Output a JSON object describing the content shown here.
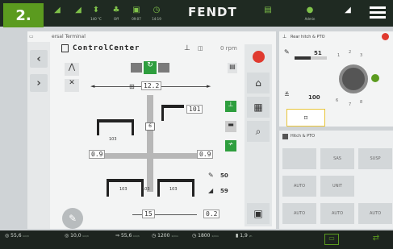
{
  "step_badge": "2.",
  "brand": "FENDT",
  "top_labels": [
    "140 °C",
    "Off",
    "09:07",
    "14:19",
    "Admin"
  ],
  "panel_title": "ersal Terminal",
  "controlcenter": {
    "title": "ControlCenter",
    "rpm": "0 rpm",
    "speed_display": "12.2",
    "rear_gauge": "101",
    "left_width": "0.9",
    "right_width": "0.9",
    "left_tool": "103",
    "mid_tool": "103",
    "right_tool": "103",
    "center_mark": "6",
    "top_tool_val": "103",
    "bottom_width": "15",
    "bottom_right_val": "0.2",
    "pct_a": "50",
    "pct_b": "59"
  },
  "rear_hitch": {
    "title": "Rear hitch & PTO",
    "slider_value": "51",
    "depth_value": "100",
    "dial_labels": [
      "1",
      "2",
      "3",
      "4",
      "5",
      "6",
      "7",
      "8"
    ]
  },
  "hitch_pto": {
    "title": "Hitch & PTO",
    "tiles": [
      "",
      "SAS",
      "SUSP",
      "AUTO",
      "UNIT",
      "",
      "AUTO",
      "AUTO",
      "AUTO"
    ]
  },
  "bottom_bar": [
    {
      "value": "55,6",
      "unit": "km/h"
    },
    {
      "value": "10,0",
      "unit": "km/h"
    },
    {
      "value": "55,6",
      "unit": "km/h"
    },
    {
      "value": "1200",
      "unit": "1/min"
    },
    {
      "value": "1800",
      "unit": "1/min"
    },
    {
      "value": "1,9",
      "unit": "l/h"
    }
  ],
  "colors": {
    "accent_green": "#5b9b1f",
    "alert_red": "#e03a2f",
    "topbar": "#1f2a22"
  }
}
